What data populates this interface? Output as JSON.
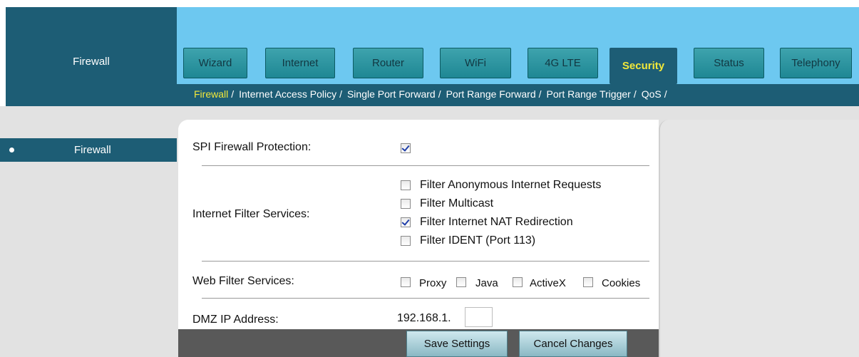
{
  "header": {
    "title": "Firewall"
  },
  "tabs": [
    {
      "label": "Wizard",
      "active": false
    },
    {
      "label": "Internet",
      "active": false
    },
    {
      "label": "Router",
      "active": false
    },
    {
      "label": "WiFi",
      "active": false
    },
    {
      "label": "4G LTE",
      "active": false
    },
    {
      "label": "Security",
      "active": true
    },
    {
      "label": "Status",
      "active": false
    },
    {
      "label": "Telephony",
      "active": false
    }
  ],
  "subnav": [
    {
      "label": "Firewall",
      "active": true
    },
    {
      "label": "Internet Access Policy",
      "active": false
    },
    {
      "label": "Single Port Forward",
      "active": false
    },
    {
      "label": "Port Range Forward",
      "active": false
    },
    {
      "label": "Port Range Trigger",
      "active": false
    },
    {
      "label": "QoS",
      "active": false
    }
  ],
  "subnav_separator": "/",
  "sidebar": {
    "items": [
      {
        "label": "Firewall",
        "selected": true
      }
    ]
  },
  "form": {
    "spi": {
      "label": "SPI Firewall Protection:",
      "checked": true
    },
    "internet_filter": {
      "label": "Internet Filter Services:",
      "options": [
        {
          "label": "Filter Anonymous Internet Requests",
          "checked": false
        },
        {
          "label": "Filter Multicast",
          "checked": false
        },
        {
          "label": "Filter Internet NAT Redirection",
          "checked": true
        },
        {
          "label": "Filter IDENT (Port 113)",
          "checked": false
        }
      ]
    },
    "web_filter": {
      "label": "Web Filter Services:",
      "options": [
        {
          "label": "Proxy",
          "checked": false
        },
        {
          "label": "Java",
          "checked": false
        },
        {
          "label": "ActiveX",
          "checked": false
        },
        {
          "label": "Cookies",
          "checked": false
        }
      ]
    },
    "dmz": {
      "label": "DMZ IP Address:",
      "prefix": "192.168.1.",
      "value": ""
    }
  },
  "buttons": {
    "save": "Save Settings",
    "cancel": "Cancel Changes"
  },
  "colors": {
    "dark_teal": "#1d5d75",
    "sky": "#6dc8f0",
    "active_text": "#f2e83a"
  }
}
